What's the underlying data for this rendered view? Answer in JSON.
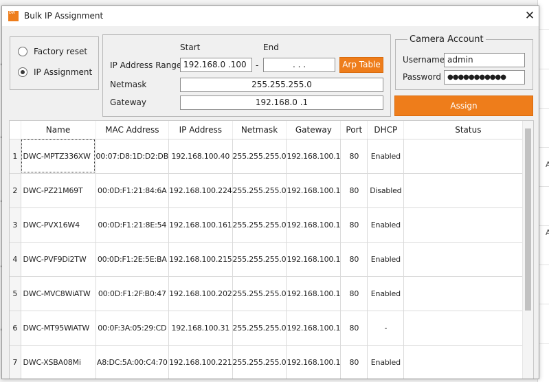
{
  "window": {
    "title": "Bulk IP Assignment",
    "close_glyph": "✕",
    "icon_text": "DW"
  },
  "mode": {
    "factory_reset_label": "Factory reset",
    "ip_assignment_label": "IP Assignment",
    "selected": "ip_assignment"
  },
  "range": {
    "start_header": "Start",
    "end_header": "End",
    "ip_range_label": "IP Address Range",
    "start_value": "192.168.0  .100",
    "separator": "-",
    "end_value": ".     .     .",
    "arp_button": "Arp Table",
    "netmask_label": "Netmask",
    "netmask_value": "255.255.255.0",
    "gateway_label": "Gateway",
    "gateway_value": "192.168.0  .1"
  },
  "account": {
    "legend": "Camera Account",
    "username_label": "Username",
    "username_value": "admin",
    "password_label": "Password",
    "password_value": "●●●●●●●●●●●"
  },
  "assign_button": "Assign",
  "table": {
    "columns": [
      "Name",
      "MAC Address",
      "IP Address",
      "Netmask",
      "Gateway",
      "Port",
      "DHCP",
      "Status"
    ],
    "rows": [
      {
        "no": "1",
        "name": "DWC-MPTZ336XW",
        "mac": "00:07:D8:1D:D2:DB",
        "ip": "192.168.100.40",
        "netmask": "255.255.255.0",
        "gateway": "192.168.100.1",
        "port": "80",
        "dhcp": "Enabled",
        "status": ""
      },
      {
        "no": "2",
        "name": "DWC-PZ21M69T",
        "mac": "00:0D:F1:21:84:6A",
        "ip": "192.168.100.224",
        "netmask": "255.255.255.0",
        "gateway": "192.168.100.1",
        "port": "80",
        "dhcp": "Disabled",
        "status": ""
      },
      {
        "no": "3",
        "name": "DWC-PVX16W4",
        "mac": "00:0D:F1:21:8E:54",
        "ip": "192.168.100.161",
        "netmask": "255.255.255.0",
        "gateway": "192.168.100.1",
        "port": "80",
        "dhcp": "Enabled",
        "status": ""
      },
      {
        "no": "4",
        "name": "DWC-PVF9Di2TW",
        "mac": "00:0D:F1:2E:5E:BA",
        "ip": "192.168.100.215",
        "netmask": "255.255.255.0",
        "gateway": "192.168.100.1",
        "port": "80",
        "dhcp": "Enabled",
        "status": ""
      },
      {
        "no": "5",
        "name": "DWC-MVC8WiATW",
        "mac": "00:0D:F1:2F:B0:47",
        "ip": "192.168.100.202",
        "netmask": "255.255.255.0",
        "gateway": "192.168.100.1",
        "port": "80",
        "dhcp": "Enabled",
        "status": ""
      },
      {
        "no": "6",
        "name": "DWC-MT95WiATW",
        "mac": "00:0F:3A:05:29:CD",
        "ip": "192.168.100.31",
        "netmask": "255.255.255.0",
        "gateway": "192.168.100.1",
        "port": "80",
        "dhcp": "-",
        "status": ""
      },
      {
        "no": "7",
        "name": "DWC-XSBA08Mi",
        "mac": "A8:DC:5A:00:C4:70",
        "ip": "192.168.100.221",
        "netmask": "255.255.255.0",
        "gateway": "192.168.100.1",
        "port": "80",
        "dhcp": "Enabled",
        "status": ""
      }
    ]
  },
  "background": {
    "right_letters": [
      "A",
      "A"
    ],
    "left_letters": [
      "/",
      "/",
      "/",
      "/",
      "/"
    ]
  },
  "colors": {
    "accent": "#ee7d1b"
  }
}
